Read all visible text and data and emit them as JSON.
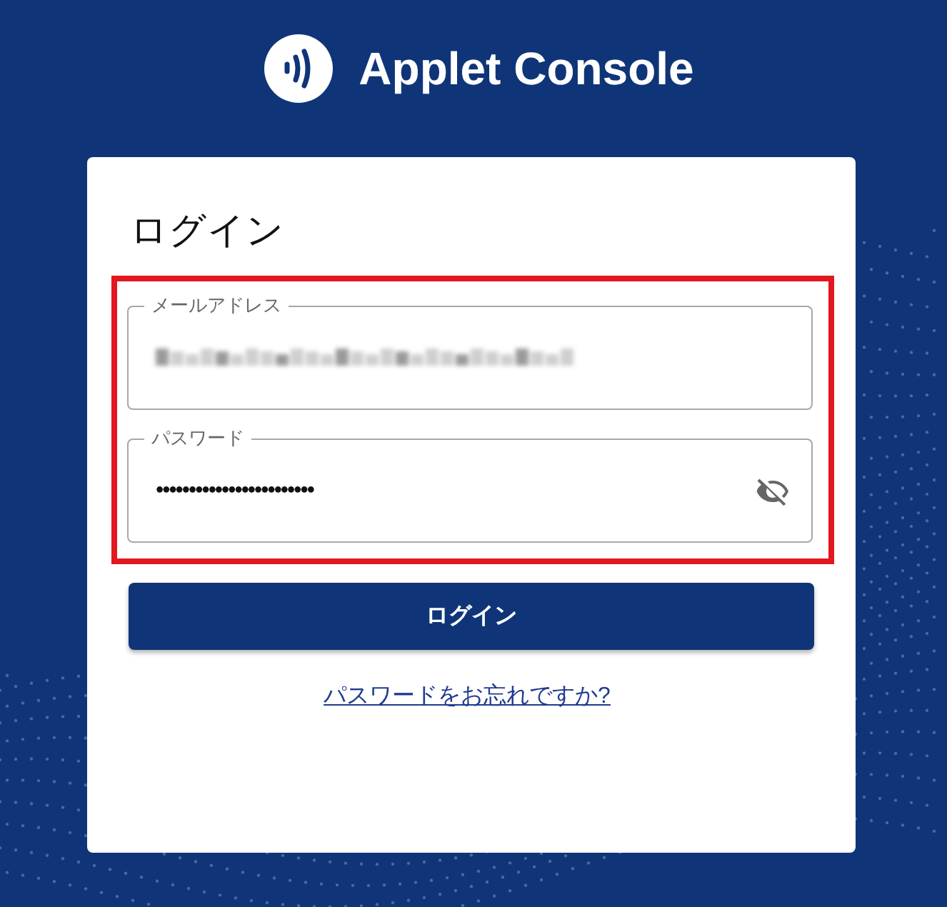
{
  "header": {
    "title": "Applet Console"
  },
  "login_card": {
    "title": "ログイン",
    "highlighted": true,
    "fields": [
      {
        "kind": "email",
        "label": "メールアドレス",
        "value_obscured": true
      },
      {
        "kind": "password",
        "label": "パスワード",
        "value": "••••••••••••••••••••••••",
        "reveal": false
      }
    ],
    "submit_button": "ログイン",
    "forgot_link": "パスワードをお忘れですか?"
  }
}
